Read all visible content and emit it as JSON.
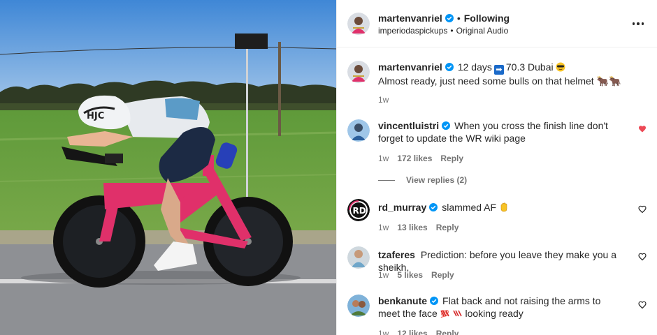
{
  "post": {
    "author": "martenvanriel",
    "separator": "•",
    "follow_state": "Following",
    "audio_user": "imperiodaspickups",
    "audio_separator": "•",
    "audio_label": "Original Audio"
  },
  "caption": {
    "username": "martenvanriel",
    "text_before_flag": "12 days",
    "text_after_flag": "70.3 Dubai",
    "line2": "Almost ready, just need some bulls on that helmet",
    "line2_emoji": "🐂🐂",
    "time": "1w"
  },
  "comments": [
    {
      "username": "vincentluistri",
      "text": "When you cross the finish line don't forget to update the WR wiki page",
      "time": "1w",
      "likes": "172 likes",
      "reply": "Reply",
      "liked": true,
      "view_replies": "View replies (2)"
    },
    {
      "username": "rd_murray",
      "text": "slammed AF",
      "time": "1w",
      "likes": "13 likes",
      "reply": "Reply",
      "liked": false
    },
    {
      "username": "tzaferes",
      "text": "Prediction: before you leave they make you a sheikh.",
      "time": "1w",
      "likes": "5 likes",
      "reply": "Reply",
      "liked": false
    },
    {
      "username": "benkanute",
      "text": "Flat back and not raising the arms to meet the face",
      "text_after": "looking ready",
      "time": "1w",
      "likes": "12 likes",
      "reply": "Reply",
      "liked": false
    }
  ],
  "colors": {
    "verified": "#0095f6",
    "liked_heart": "#ed4956",
    "bike_frame": "#e0306a",
    "sky": "#6fa6df"
  }
}
